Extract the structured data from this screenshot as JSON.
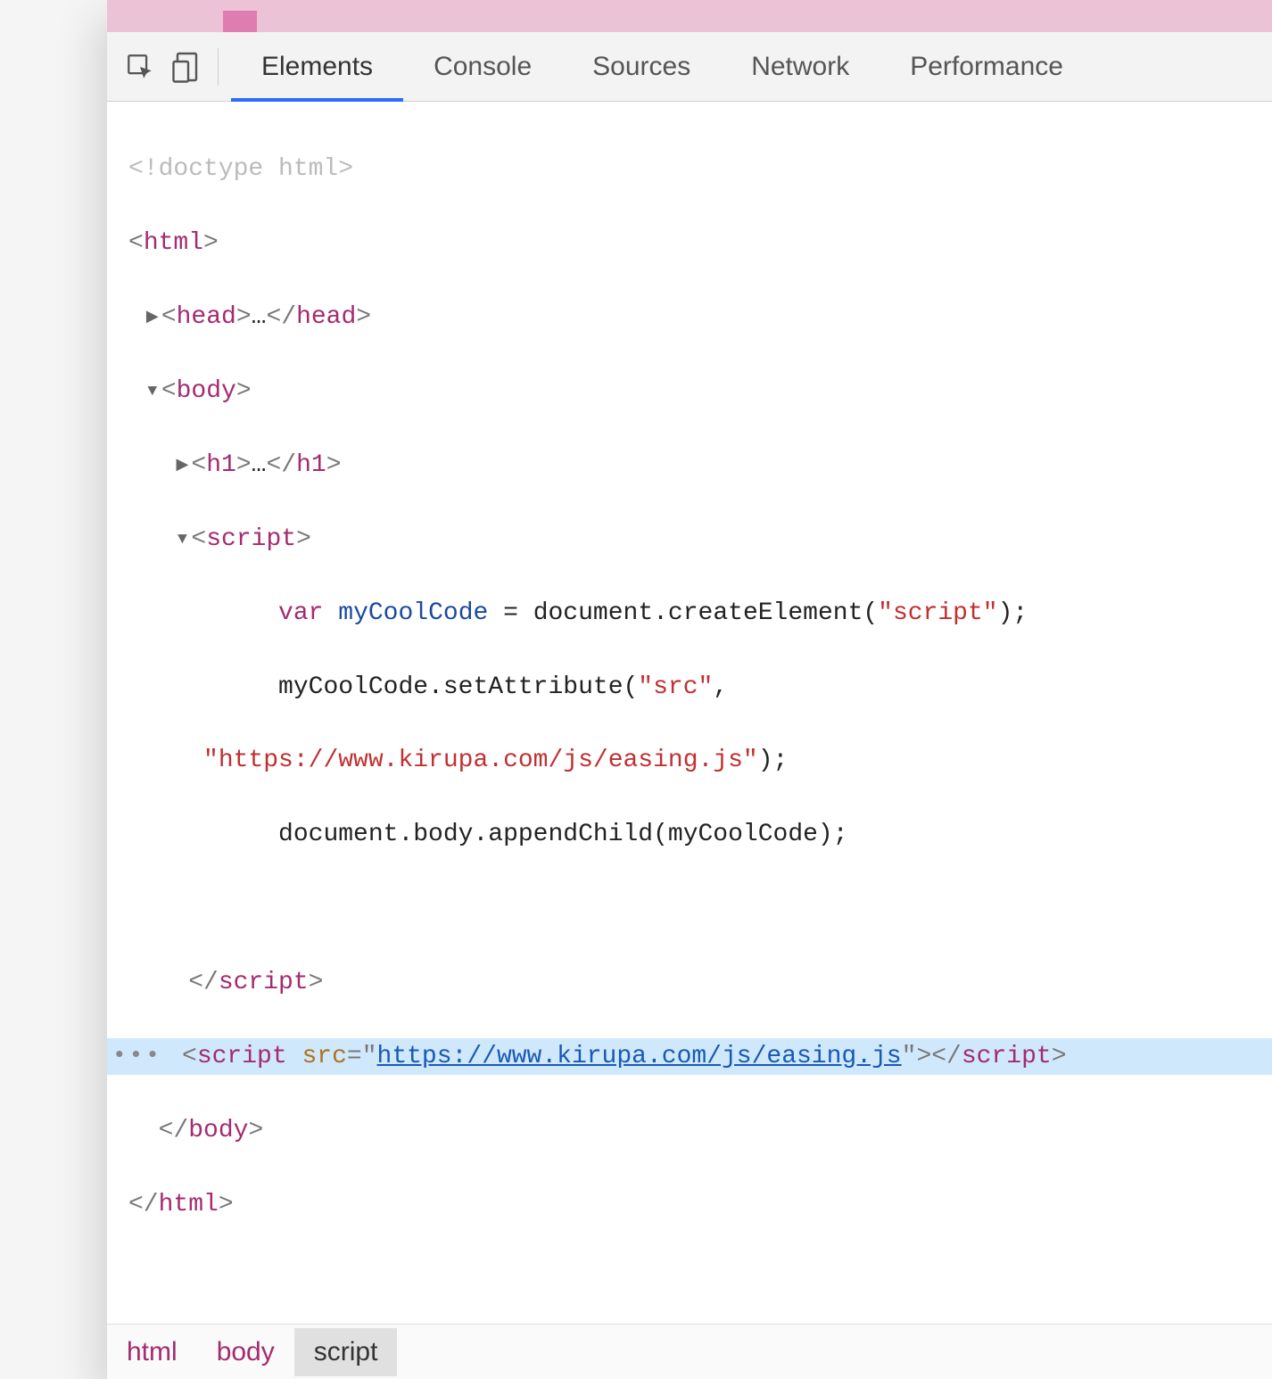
{
  "toolbar": {
    "tabs": [
      "Elements",
      "Console",
      "Sources",
      "Network",
      "Performance"
    ],
    "active_tab": "Elements"
  },
  "dom": {
    "doctype": "<!doctype html>",
    "html_tag": "html",
    "head_tag": "head",
    "body_tag": "body",
    "h1_tag": "h1",
    "script_tag": "script",
    "ellipsis": "…",
    "code": {
      "kw_var": "var",
      "varname": "myCoolCode",
      "line1_rest": " = document.createElement(",
      "str_script": "\"script\"",
      "line1_end": ");",
      "line2_a": "myCoolCode.setAttribute(",
      "str_src": "\"src\"",
      "line2_b": ", ",
      "str_url": "\"https://www.kirupa.com/js/easing.js\"",
      "line2_c": ");",
      "line3": "document.body.appendChild(myCoolCode);"
    },
    "selected": {
      "tag": "script",
      "attr": "src",
      "url": "https://www.kirupa.com/js/easing.js"
    }
  },
  "breadcrumbs": [
    "html",
    "body",
    "script"
  ],
  "breadcrumb_active": "script"
}
